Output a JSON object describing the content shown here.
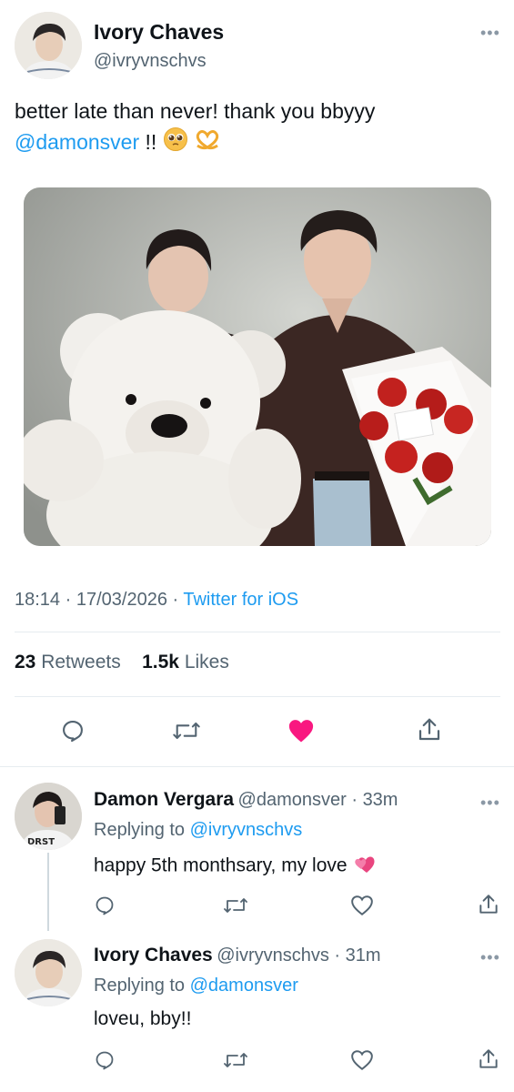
{
  "main_tweet": {
    "name": "Ivory Chaves",
    "handle": "@ivryvnschvs",
    "text_before": "better late than never! thank you bbyyy",
    "mention": "@damonsver",
    "text_after": " !!",
    "emojis": [
      "pleading-face-emoji",
      "heart-hands-emoji"
    ],
    "time": "18:14",
    "date": "17/03/2026",
    "source": "Twitter for iOS",
    "retweets_count": "23",
    "retweets_label": "Retweets",
    "likes_count": "1.5k",
    "likes_label": "Likes",
    "liked": true
  },
  "replies": [
    {
      "name": "Damon Vergara",
      "handle": "@damonsver",
      "age": "33m",
      "replying_label": "Replying to",
      "replying_to": "@ivryvnschvs",
      "text": "happy 5th monthsary, my love",
      "emoji": "sparkling-heart-emoji"
    },
    {
      "name": "Ivory Chaves",
      "handle": "@ivryvnschvs",
      "age": "31m",
      "replying_label": "Replying to",
      "replying_to": "@damonsver",
      "text": "loveu, bby!!"
    }
  ],
  "more_label": "•••",
  "separator": " · ",
  "colors": {
    "accent": "#1d9bf0",
    "like": "#f91880",
    "muted": "#536471",
    "icon": "#536471"
  }
}
